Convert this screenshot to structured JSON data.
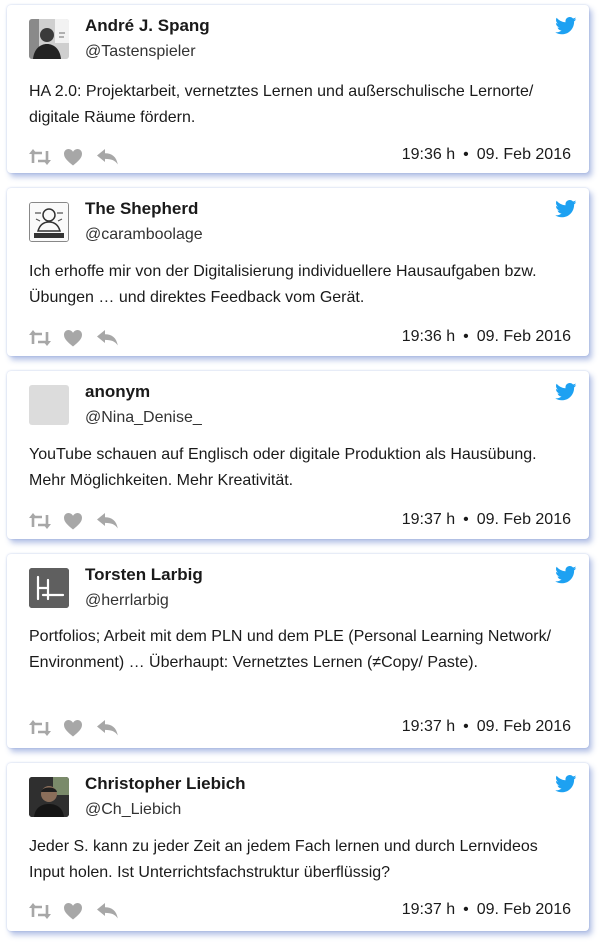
{
  "colors": {
    "accent": "#1da1f2",
    "icon_gray": "#a7a7a7"
  },
  "tweets": [
    {
      "name": "André J. Spang",
      "handle": "@Tastenspieler",
      "text": "HA 2.0: Projektarbeit, vernetztes Lernen und außerschulische Lernorte/ digitale Räume fördern.",
      "time": "19:36 h",
      "date": "09. Feb 2016"
    },
    {
      "name": "The Shepherd",
      "handle": "@caramboolage",
      "text": "Ich erhoffe mir von der Digitalisierung individuellere Hausaufgaben bzw. Übungen … und direktes Feedback vom Gerät.",
      "time": "19:36 h",
      "date": "09. Feb 2016"
    },
    {
      "name": "anonym",
      "handle": "@Nina_Denise_",
      "text": "YouTube schauen auf Englisch oder digitale Produktion als Hausübung. Mehr Möglichkeiten. Mehr Kreativität.",
      "time": "19:37 h",
      "date": "09. Feb 2016"
    },
    {
      "name": "Torsten Larbig",
      "handle": "@herrlarbig",
      "text": "Portfolios; Arbeit mit dem PLN und dem PLE (Personal Learning Network/ Environment) … Überhaupt: Vernetztes Lernen (≠Copy/ Paste).",
      "time": "19:37 h",
      "date": "09. Feb 2016"
    },
    {
      "name": "Christopher Liebich",
      "handle": "@Ch_Liebich",
      "text": "Jeder S. kann zu jeder Zeit an jedem Fach lernen und durch Lernvideos Input holen. Ist Unterrichtsfachstruktur überflüssig?",
      "time": "19:37 h",
      "date": "09. Feb 2016"
    }
  ]
}
